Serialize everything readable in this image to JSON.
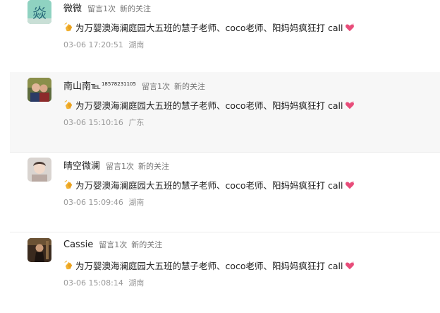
{
  "comments": [
    {
      "name": "微微",
      "name_sup": "",
      "count_label": "留言1次",
      "follow_label": "新的关注",
      "text": "为万婴澳海澜庭园大五班的慧子老师、coco老师、阳妈妈疯狂打 call",
      "time": "03-06 17:20:51",
      "location": "湖南",
      "avatar_glyph": "焱"
    },
    {
      "name": "南山南℡",
      "name_sup": "18578231105",
      "count_label": "留言1次",
      "follow_label": "新的关注",
      "text": "为万婴澳海澜庭园大五班的慧子老师、coco老师、阳妈妈疯狂打 call",
      "time": "03-06 15:10:16",
      "location": "广东",
      "avatar_glyph": ""
    },
    {
      "name": "晴空微澜",
      "name_sup": "",
      "count_label": "留言1次",
      "follow_label": "新的关注",
      "text": "为万婴澳海澜庭园大五班的慧子老师、coco老师、阳妈妈疯狂打 call",
      "time": "03-06 15:09:46",
      "location": "湖南",
      "avatar_glyph": ""
    },
    {
      "name": "Cassie",
      "name_sup": "",
      "count_label": "留言1次",
      "follow_label": "新的关注",
      "text": "为万婴澳海澜庭园大五班的慧子老师、coco老师、阳妈妈疯狂打 call",
      "time": "03-06 15:08:14",
      "location": "湖南",
      "avatar_glyph": ""
    }
  ],
  "colors": {
    "alt_row_bg": "#f7f7f7",
    "meta_text": "#777777",
    "footer_text": "#999999",
    "heart": "#e84d7a",
    "clap": "#f2b233"
  },
  "icons": {
    "clap": "clapping-hands-icon",
    "heart": "sparkling-heart-icon"
  }
}
